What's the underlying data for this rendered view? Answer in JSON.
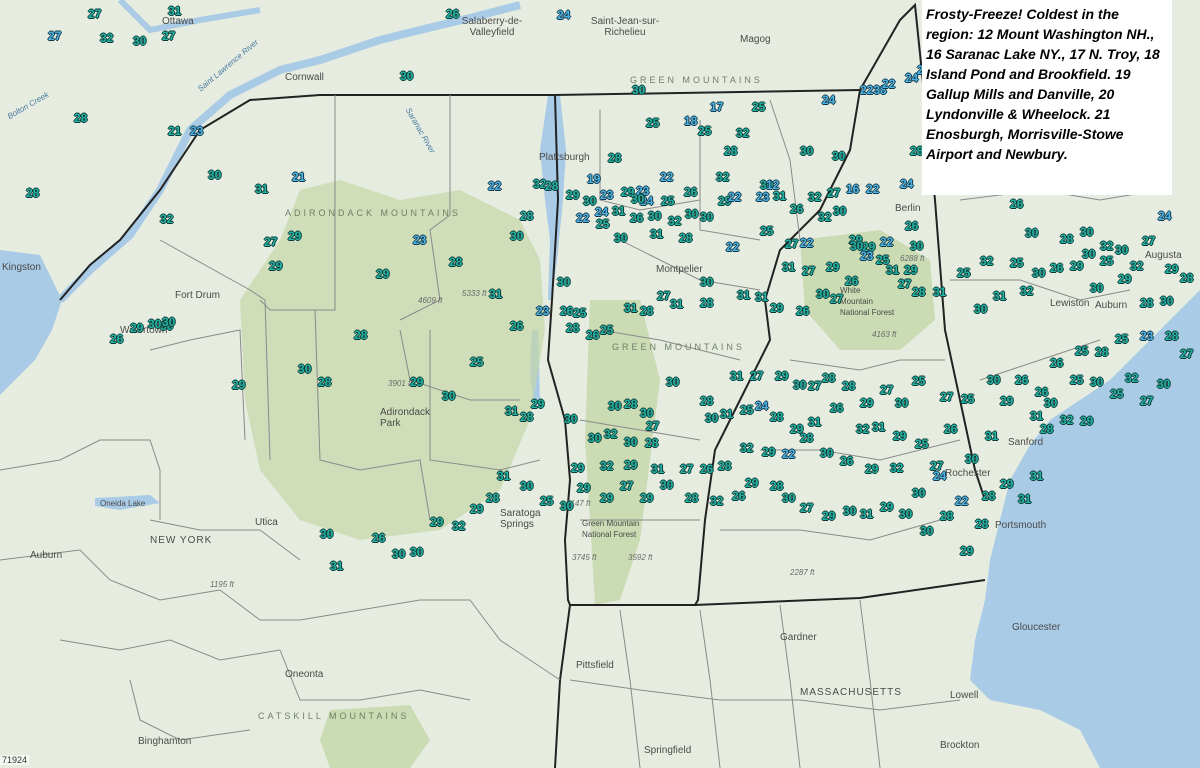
{
  "note": {
    "text": "Frosty-Freeze! Coldest in the region: 12 Mount Washington NH., 16 Saranac Lake NY., 17 N. Troy, 18 Island Pond and Brookfield. 19 Gallup Mills and Danville, 20 Lyndonville & Wheelock. 21 Enosburgh, Morrisville-Stowe Airport and Newbury."
  },
  "places": [
    {
      "id": "ottawa",
      "name": "Ottawa"
    },
    {
      "id": "salaberry",
      "name": "Salaberry-de-Valleyfield"
    },
    {
      "id": "st-jean",
      "name": "Saint-Jean-sur-Richelieu"
    },
    {
      "id": "magog",
      "name": "Magog"
    },
    {
      "id": "cornwall",
      "name": "Cornwall"
    },
    {
      "id": "kingston",
      "name": "Kingston"
    },
    {
      "id": "plattsburgh",
      "name": "Plattsburgh"
    },
    {
      "id": "montpelier",
      "name": "Montpelier"
    },
    {
      "id": "berlin",
      "name": "Berlin"
    },
    {
      "id": "augusta",
      "name": "Augusta"
    },
    {
      "id": "lewiston",
      "name": "Lewiston"
    },
    {
      "id": "auburn-me",
      "name": "Auburn"
    },
    {
      "id": "fort-drum",
      "name": "Fort Drum"
    },
    {
      "id": "watertown",
      "name": "Watertown"
    },
    {
      "id": "adirondack-park",
      "name": "Adirondack Park"
    },
    {
      "id": "utica",
      "name": "Utica"
    },
    {
      "id": "new-york",
      "name": "NEW YORK"
    },
    {
      "id": "auburn-ny",
      "name": "Auburn"
    },
    {
      "id": "oneonta",
      "name": "Oneonta"
    },
    {
      "id": "binghamton",
      "name": "Binghamton"
    },
    {
      "id": "saratoga",
      "name": "Saratoga Springs"
    },
    {
      "id": "pittsfield",
      "name": "Pittsfield"
    },
    {
      "id": "springfield",
      "name": "Springfield"
    },
    {
      "id": "gardner",
      "name": "Gardner"
    },
    {
      "id": "massachusetts",
      "name": "MASSACHUSETTS"
    },
    {
      "id": "gloucester",
      "name": "Gloucester"
    },
    {
      "id": "lowell",
      "name": "Lowell"
    },
    {
      "id": "brockton",
      "name": "Brockton"
    },
    {
      "id": "rochester",
      "name": "Rochester"
    },
    {
      "id": "sanford",
      "name": "Sanford"
    },
    {
      "id": "portsmouth",
      "name": "Portsmouth"
    },
    {
      "id": "oneida-lake",
      "name": "Oneida Lake"
    },
    {
      "id": "green-mtn-forest",
      "name": "Green Mountain National Forest"
    },
    {
      "id": "white-mtn-forest",
      "name": "White Mountain National Forest"
    },
    {
      "id": "saranac-river",
      "name": "Saranac River"
    },
    {
      "id": "bolton-creek",
      "name": "Bolton Creek"
    },
    {
      "id": "st-lawrence",
      "name": "Saint Lawrence River"
    }
  ],
  "regions": [
    {
      "id": "green-mountains",
      "name": "GREEN MOUNTAINS"
    },
    {
      "id": "adirondack-mountains",
      "name": "ADIRONDACK MOUNTAINS"
    },
    {
      "id": "green-mountains-south",
      "name": "GREEN MOUNTAINS"
    },
    {
      "id": "catskill-mountains",
      "name": "CATSKILL MOUNTAINS"
    }
  ],
  "elevations": [
    "4609 ft",
    "5333 ft",
    "3901 ft",
    "6288 ft",
    "4163 ft",
    "3147 ft",
    "3745 ft",
    "3592 ft",
    "1195 ft",
    "2287 ft"
  ],
  "scale_label": "71924",
  "temperatures": [
    {
      "v": "31",
      "c": 1
    },
    {
      "v": "30",
      "c": 1
    },
    {
      "v": "27",
      "c": 1
    },
    {
      "v": "32",
      "c": 1
    },
    {
      "v": "27",
      "c": 2
    },
    {
      "v": "27",
      "c": 1
    },
    {
      "v": "24",
      "c": 2
    },
    {
      "v": "26",
      "c": 1
    },
    {
      "v": "30",
      "c": 1
    },
    {
      "v": "30",
      "c": 1
    },
    {
      "v": "17",
      "c": 2
    },
    {
      "v": "25",
      "c": 1
    },
    {
      "v": "24",
      "c": 2
    },
    {
      "v": "2238",
      "c": 2
    },
    {
      "v": "22",
      "c": 2
    },
    {
      "v": "24",
      "c": 2
    },
    {
      "v": "24",
      "c": 2
    },
    {
      "v": "28",
      "c": 1
    },
    {
      "v": "21",
      "c": 1
    },
    {
      "v": "23",
      "c": 2
    },
    {
      "v": "25",
      "c": 1
    },
    {
      "v": "18",
      "c": 2
    },
    {
      "v": "25",
      "c": 1
    },
    {
      "v": "32",
      "c": 1
    },
    {
      "v": "28",
      "c": 1
    },
    {
      "v": "30",
      "c": 1
    },
    {
      "v": "30",
      "c": 1
    },
    {
      "v": "28",
      "c": 1
    },
    {
      "v": "30",
      "c": 1
    },
    {
      "v": "31",
      "c": 1
    },
    {
      "v": "21",
      "c": 2
    },
    {
      "v": "22",
      "c": 2
    },
    {
      "v": "32",
      "c": 1
    },
    {
      "v": "28",
      "c": 1
    },
    {
      "v": "28",
      "c": 1
    },
    {
      "v": "19",
      "c": 2
    },
    {
      "v": "22",
      "c": 2
    },
    {
      "v": "32",
      "c": 1
    },
    {
      "v": "30",
      "c": 1
    },
    {
      "v": "32",
      "c": 1
    },
    {
      "v": "16",
      "c": 2
    },
    {
      "v": "22",
      "c": 2
    },
    {
      "v": "24",
      "c": 2
    },
    {
      "v": "28",
      "c": 1
    },
    {
      "v": "24",
      "c": 2
    },
    {
      "v": "25",
      "c": 1
    },
    {
      "v": "31",
      "c": 1
    },
    {
      "v": "26",
      "c": 1
    },
    {
      "v": "30",
      "c": 1
    },
    {
      "v": "32",
      "c": 1
    },
    {
      "v": "30",
      "c": 1
    },
    {
      "v": "29",
      "c": 1
    },
    {
      "v": "12",
      "c": 2
    },
    {
      "v": "26",
      "c": 1
    },
    {
      "v": "32",
      "c": 1
    },
    {
      "v": "30",
      "c": 1
    },
    {
      "v": "32",
      "c": 1
    },
    {
      "v": "23",
      "c": 2
    },
    {
      "v": "29",
      "c": 1
    },
    {
      "v": "30",
      "c": 1
    },
    {
      "v": "23",
      "c": 2
    },
    {
      "v": "26",
      "c": 1
    },
    {
      "v": "30",
      "c": 1
    },
    {
      "v": "22",
      "c": 2
    },
    {
      "v": "23",
      "c": 2
    },
    {
      "v": "31",
      "c": 1
    },
    {
      "v": "27",
      "c": 1
    },
    {
      "v": "29",
      "c": 1
    },
    {
      "v": "22",
      "c": 2
    },
    {
      "v": "24",
      "c": 2
    },
    {
      "v": "30",
      "c": 1
    },
    {
      "v": "25",
      "c": 1
    },
    {
      "v": "28",
      "c": 1
    },
    {
      "v": "27",
      "c": 1
    },
    {
      "v": "29",
      "c": 1
    },
    {
      "v": "23",
      "c": 2
    },
    {
      "v": "28",
      "c": 1
    },
    {
      "v": "30",
      "c": 1
    },
    {
      "v": "30",
      "c": 1
    },
    {
      "v": "31",
      "c": 1
    },
    {
      "v": "28",
      "c": 1
    },
    {
      "v": "22",
      "c": 2
    },
    {
      "v": "25",
      "c": 1
    },
    {
      "v": "27",
      "c": 1
    },
    {
      "v": "22",
      "c": 2
    },
    {
      "v": "29",
      "c": 1
    },
    {
      "v": "29",
      "c": 1
    },
    {
      "v": "22",
      "c": 2
    },
    {
      "v": "26",
      "c": 1
    },
    {
      "v": "26",
      "c": 1
    },
    {
      "v": "24",
      "c": 2
    },
    {
      "v": "30",
      "c": 1
    },
    {
      "v": "30",
      "c": 1
    },
    {
      "v": "30",
      "c": 1
    },
    {
      "v": "32",
      "c": 1
    },
    {
      "v": "30",
      "c": 1
    },
    {
      "v": "27",
      "c": 1
    },
    {
      "v": "28",
      "c": 1
    },
    {
      "v": "30",
      "c": 1
    },
    {
      "v": "25",
      "c": 1
    },
    {
      "v": "32",
      "c": 1
    },
    {
      "v": "29",
      "c": 1
    },
    {
      "v": "30",
      "c": 1
    },
    {
      "v": "28",
      "c": 1
    },
    {
      "v": "25",
      "c": 1
    },
    {
      "v": "32",
      "c": 1
    },
    {
      "v": "25",
      "c": 1
    },
    {
      "v": "30",
      "c": 1
    },
    {
      "v": "26",
      "c": 1
    },
    {
      "v": "29",
      "c": 1
    },
    {
      "v": "30",
      "c": 1
    },
    {
      "v": "29",
      "c": 1
    },
    {
      "v": "28",
      "c": 1
    },
    {
      "v": "32",
      "c": 1
    },
    {
      "v": "31",
      "c": 1
    },
    {
      "v": "30",
      "c": 1
    },
    {
      "v": "31",
      "c": 1
    },
    {
      "v": "27",
      "c": 1
    },
    {
      "v": "25",
      "c": 1
    },
    {
      "v": "23",
      "c": 2
    },
    {
      "v": "30",
      "c": 1
    },
    {
      "v": "31",
      "c": 1
    },
    {
      "v": "29",
      "c": 1
    },
    {
      "v": "28",
      "c": 1
    },
    {
      "v": "26",
      "c": 1
    },
    {
      "v": "29",
      "c": 1
    },
    {
      "v": "31",
      "c": 1
    },
    {
      "v": "27",
      "c": 1
    },
    {
      "v": "30",
      "c": 1
    },
    {
      "v": "27",
      "c": 1
    },
    {
      "v": "26",
      "c": 1
    },
    {
      "v": "29",
      "c": 1
    },
    {
      "v": "31",
      "c": 1
    },
    {
      "v": "31",
      "c": 1
    },
    {
      "v": "28",
      "c": 1
    },
    {
      "v": "30",
      "c": 1
    },
    {
      "v": "31",
      "c": 1
    },
    {
      "v": "27",
      "c": 1
    },
    {
      "v": "28",
      "c": 1
    },
    {
      "v": "31",
      "c": 1
    },
    {
      "v": "25",
      "c": 1
    },
    {
      "v": "26",
      "c": 1
    },
    {
      "v": "25",
      "c": 1
    },
    {
      "v": "30",
      "c": 1
    },
    {
      "v": "26",
      "c": 1
    },
    {
      "v": "28",
      "c": 1
    },
    {
      "v": "26",
      "c": 1
    },
    {
      "v": "23",
      "c": 2
    },
    {
      "v": "31",
      "c": 1
    },
    {
      "v": "29",
      "c": 1
    },
    {
      "v": "29",
      "c": 1
    },
    {
      "v": "30",
      "c": 1
    },
    {
      "v": "26",
      "c": 1
    },
    {
      "v": "29",
      "c": 1
    },
    {
      "v": "30",
      "c": 1
    },
    {
      "v": "30",
      "c": 1
    },
    {
      "v": "29",
      "c": 1
    },
    {
      "v": "30",
      "c": 1
    },
    {
      "v": "28",
      "c": 1
    },
    {
      "v": "28",
      "c": 1
    },
    {
      "v": "29",
      "c": 1
    },
    {
      "v": "30",
      "c": 1
    },
    {
      "v": "25",
      "c": 1
    },
    {
      "v": "31",
      "c": 1
    },
    {
      "v": "28",
      "c": 1
    },
    {
      "v": "29",
      "c": 1
    },
    {
      "v": "30",
      "c": 1
    },
    {
      "v": "30",
      "c": 1
    },
    {
      "v": "28",
      "c": 1
    },
    {
      "v": "30",
      "c": 1
    },
    {
      "v": "27",
      "c": 1
    },
    {
      "v": "30",
      "c": 1
    },
    {
      "v": "28",
      "c": 1
    },
    {
      "v": "31",
      "c": 1
    },
    {
      "v": "27",
      "c": 1
    },
    {
      "v": "29",
      "c": 1
    },
    {
      "v": "30",
      "c": 1
    },
    {
      "v": "27",
      "c": 1
    },
    {
      "v": "28",
      "c": 1
    },
    {
      "v": "28",
      "c": 1
    },
    {
      "v": "29",
      "c": 1
    },
    {
      "v": "27",
      "c": 1
    },
    {
      "v": "30",
      "c": 1
    },
    {
      "v": "25",
      "c": 1
    },
    {
      "v": "27",
      "c": 1
    },
    {
      "v": "25",
      "c": 1
    },
    {
      "v": "30",
      "c": 1
    },
    {
      "v": "29",
      "c": 1
    },
    {
      "v": "26",
      "c": 1
    },
    {
      "v": "26",
      "c": 1
    },
    {
      "v": "30",
      "c": 1
    },
    {
      "v": "26",
      "c": 1
    },
    {
      "v": "25",
      "c": 1
    },
    {
      "v": "28",
      "c": 1
    },
    {
      "v": "25",
      "c": 1
    },
    {
      "v": "23",
      "c": 2
    },
    {
      "v": "28",
      "c": 1
    },
    {
      "v": "27",
      "c": 1
    },
    {
      "v": "25",
      "c": 1
    },
    {
      "v": "30",
      "c": 1
    },
    {
      "v": "25",
      "c": 1
    },
    {
      "v": "32",
      "c": 1
    },
    {
      "v": "27",
      "c": 1
    },
    {
      "v": "30",
      "c": 1
    },
    {
      "v": "32",
      "c": 1
    },
    {
      "v": "29",
      "c": 1
    },
    {
      "v": "31",
      "c": 1
    },
    {
      "v": "28",
      "c": 1
    },
    {
      "v": "31",
      "c": 1
    },
    {
      "v": "30",
      "c": 1
    },
    {
      "v": "26",
      "c": 1
    },
    {
      "v": "27",
      "c": 1
    },
    {
      "v": "25",
      "c": 1
    },
    {
      "v": "29",
      "c": 1
    },
    {
      "v": "31",
      "c": 1
    },
    {
      "v": "32",
      "c": 1
    },
    {
      "v": "26",
      "c": 1
    },
    {
      "v": "31",
      "c": 1
    },
    {
      "v": "29",
      "c": 1
    },
    {
      "v": "28",
      "c": 1
    },
    {
      "v": "24",
      "c": 2
    },
    {
      "v": "25",
      "c": 1
    },
    {
      "v": "31",
      "c": 1
    },
    {
      "v": "30",
      "c": 1
    },
    {
      "v": "28",
      "c": 1
    },
    {
      "v": "30",
      "c": 1
    },
    {
      "v": "32",
      "c": 1
    },
    {
      "v": "30",
      "c": 1
    },
    {
      "v": "29",
      "c": 1
    },
    {
      "v": "32",
      "c": 1
    },
    {
      "v": "29",
      "c": 1
    },
    {
      "v": "31",
      "c": 1
    },
    {
      "v": "27",
      "c": 1
    },
    {
      "v": "26",
      "c": 1
    },
    {
      "v": "28",
      "c": 1
    },
    {
      "v": "32",
      "c": 1
    },
    {
      "v": "29",
      "c": 1
    },
    {
      "v": "22",
      "c": 2
    },
    {
      "v": "28",
      "c": 1
    },
    {
      "v": "30",
      "c": 1
    },
    {
      "v": "26",
      "c": 1
    },
    {
      "v": "29",
      "c": 1
    },
    {
      "v": "32",
      "c": 1
    },
    {
      "v": "30",
      "c": 1
    },
    {
      "v": "24",
      "c": 2
    },
    {
      "v": "22",
      "c": 2
    },
    {
      "v": "28",
      "c": 1
    },
    {
      "v": "29",
      "c": 1
    },
    {
      "v": "31",
      "c": 1
    },
    {
      "v": "31",
      "c": 1
    },
    {
      "v": "28",
      "c": 1
    },
    {
      "v": "29",
      "c": 1
    },
    {
      "v": "28",
      "c": 1
    },
    {
      "v": "30",
      "c": 1
    },
    {
      "v": "30",
      "c": 1
    },
    {
      "v": "29",
      "c": 1
    },
    {
      "v": "31",
      "c": 1
    },
    {
      "v": "30",
      "c": 1
    },
    {
      "v": "29",
      "c": 1
    },
    {
      "v": "27",
      "c": 1
    },
    {
      "v": "30",
      "c": 1
    },
    {
      "v": "28",
      "c": 1
    },
    {
      "v": "29",
      "c": 1
    },
    {
      "v": "26",
      "c": 1
    },
    {
      "v": "32",
      "c": 1
    },
    {
      "v": "28",
      "c": 1
    },
    {
      "v": "30",
      "c": 1
    },
    {
      "v": "29",
      "c": 1
    },
    {
      "v": "27",
      "c": 1
    },
    {
      "v": "29",
      "c": 1
    },
    {
      "v": "29",
      "c": 1
    },
    {
      "v": "30",
      "c": 1
    },
    {
      "v": "25",
      "c": 1
    },
    {
      "v": "30",
      "c": 1
    },
    {
      "v": "31",
      "c": 1
    },
    {
      "v": "28",
      "c": 1
    },
    {
      "v": "29",
      "c": 1
    },
    {
      "v": "32",
      "c": 1
    },
    {
      "v": "29",
      "c": 1
    },
    {
      "v": "30",
      "c": 1
    },
    {
      "v": "30",
      "c": 1
    },
    {
      "v": "26",
      "c": 1
    },
    {
      "v": "30",
      "c": 1
    },
    {
      "v": "31",
      "c": 1
    }
  ]
}
